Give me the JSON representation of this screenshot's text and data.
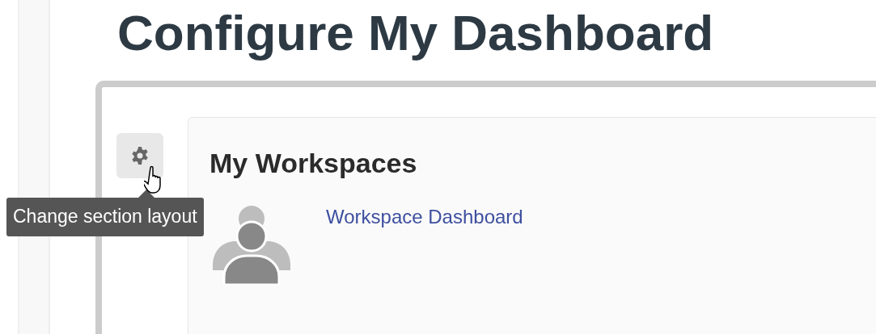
{
  "page_title": "Configure My Dashboard",
  "section": {
    "settings_tooltip": "Change section layout",
    "card": {
      "heading": "My Workspaces",
      "items": [
        {
          "link": "Workspace Dashboard"
        }
      ]
    }
  }
}
